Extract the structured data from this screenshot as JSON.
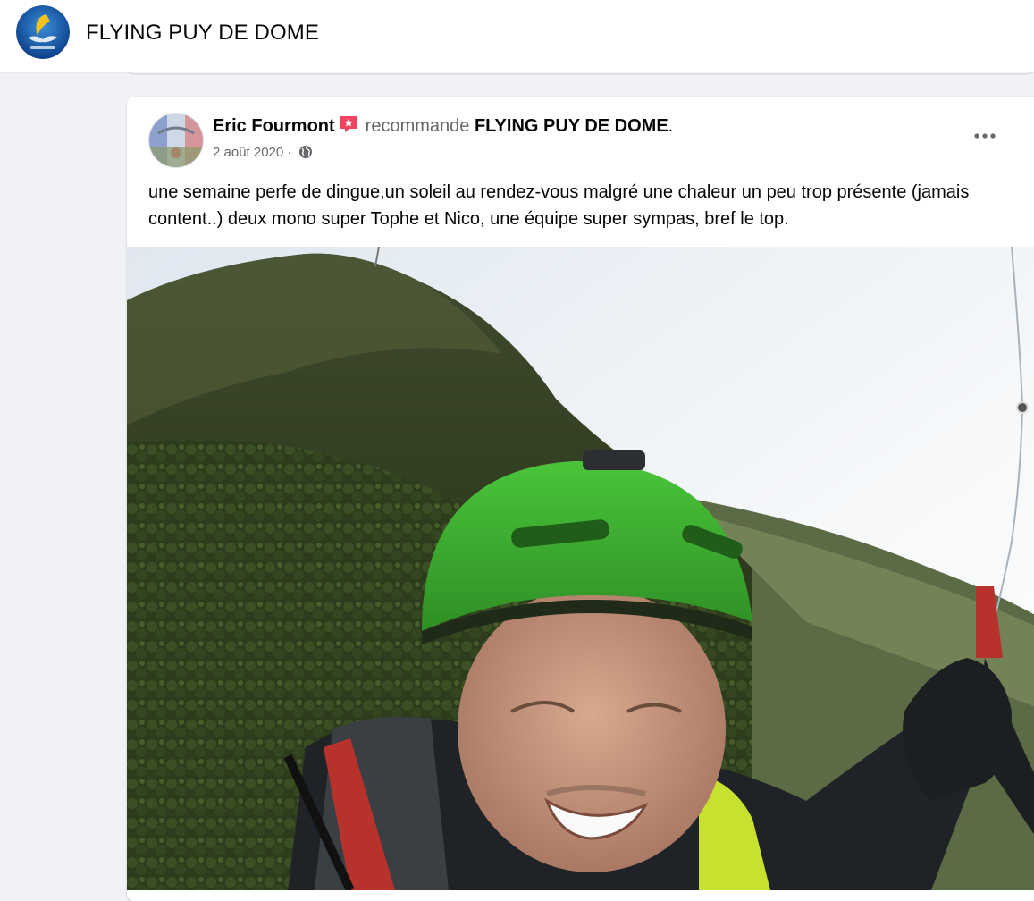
{
  "page": {
    "title": "FLYING PUY DE DOME"
  },
  "post": {
    "author": "Eric Fourmont",
    "action": "recommande",
    "target": "FLYING PUY DE DOME",
    "date": "2 août 2020 ·",
    "privacy_icon": "globe-icon",
    "more_icon": "more-options-icon",
    "recommend_icon": "recommend-badge-icon",
    "text": "une semaine perfe de dingue,un soleil au rendez-vous malgré une chaleur un peu trop présente (jamais content..) deux mono super Tophe et Nico, une équipe super sympas, bref le top.",
    "photo_description_icon": "paragliding-selfie-photo"
  },
  "colors": {
    "accent": "#1877f2",
    "secondary_text": "#65676b",
    "badge": "#f3425f",
    "background": "#f0f2f5"
  }
}
